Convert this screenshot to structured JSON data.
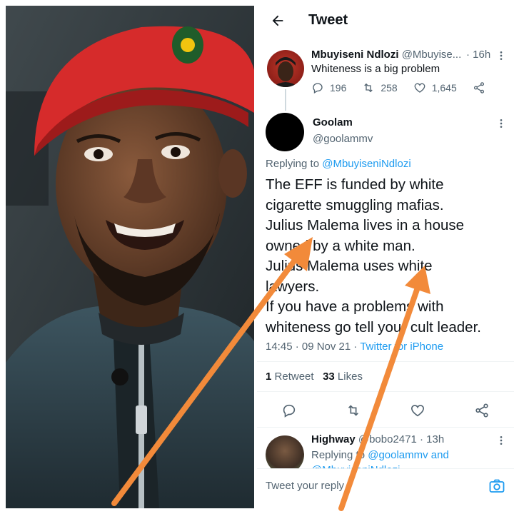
{
  "header": {
    "title": "Tweet",
    "back_icon": "back-arrow-icon"
  },
  "original_tweet": {
    "author_name": "Mbuyiseni Ndlozi",
    "author_handle": "@Mbuyise...",
    "time": "· 16h",
    "text": "Whiteness is a big problem",
    "replies": "196",
    "retweets": "258",
    "likes": "1,645"
  },
  "main_tweet": {
    "author_name": "Goolam",
    "author_handle": "@goolammv",
    "replying_label": "Replying to",
    "replying_handle": "@MbuyiseniNdlozi",
    "lines": [
      "The EFF is funded by white",
      "cigarette smuggling mafias.",
      "Julius Malema lives in a house",
      "owned by a white man.",
      "Julius Malema uses white",
      "lawyers.",
      "If you have a problems with",
      "whiteness go tell your cult leader."
    ],
    "timestamp": "14:45 · 09 Nov 21 · ",
    "source": "Twitter for iPhone",
    "retweet_count": "1",
    "retweet_label": "Retweet",
    "like_count": "33",
    "like_label": "Likes"
  },
  "reply": {
    "author_name": "Highway",
    "author_handle": "@bobo2471 · 13h",
    "replying_label": "Replying to",
    "replying_handles": "@goolammv and",
    "replying_cut": "@MbuyiseniNdlozi"
  },
  "composer": {
    "placeholder": "Tweet your reply"
  },
  "colors": {
    "accent": "#1d9bf0",
    "arrow": "#f28a3a",
    "beret": "#d62b2b"
  }
}
